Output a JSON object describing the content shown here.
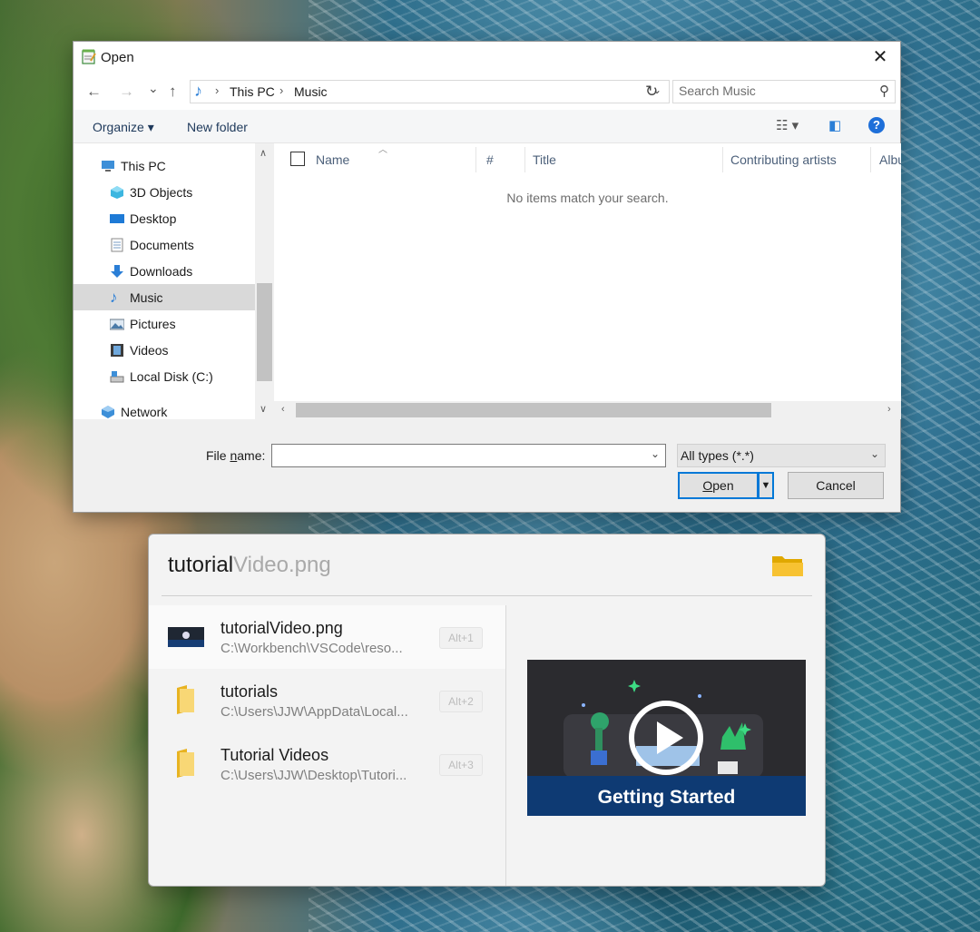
{
  "dialog": {
    "title": "Open",
    "close_glyph": "✕",
    "nav": {
      "back": "←",
      "forward": "→",
      "recent": "⌄",
      "up": "↑",
      "refresh": "↻"
    },
    "address": [
      "This PC",
      "Music"
    ],
    "search_placeholder": "Search Music",
    "commands": {
      "organize": "Organize ▾",
      "new_folder": "New folder"
    },
    "help_glyph": "?",
    "tree": [
      {
        "label": "This PC",
        "icon": "this-pc-icon"
      },
      {
        "label": "3D Objects",
        "icon": "3d-objects-icon"
      },
      {
        "label": "Desktop",
        "icon": "desktop-icon"
      },
      {
        "label": "Documents",
        "icon": "documents-icon"
      },
      {
        "label": "Downloads",
        "icon": "downloads-icon"
      },
      {
        "label": "Music",
        "icon": "music-icon",
        "selected": true
      },
      {
        "label": "Pictures",
        "icon": "pictures-icon"
      },
      {
        "label": "Videos",
        "icon": "videos-icon"
      },
      {
        "label": "Local Disk (C:)",
        "icon": "drive-icon"
      },
      {
        "label": "Network",
        "icon": "network-icon"
      }
    ],
    "columns": [
      "Name",
      "#",
      "Title",
      "Contributing artists",
      "Albu"
    ],
    "empty_message": "No items match your search.",
    "file_name_label_pre": "File ",
    "file_name_label_u": "n",
    "file_name_label_post": "ame:",
    "file_name_value": "",
    "file_type": "All types (*.*)",
    "open_label_u": "O",
    "open_label_rest": "pen",
    "cancel_label": "Cancel"
  },
  "quick_panel": {
    "query_typed": "tutorial",
    "query_suggestion": "Video.png",
    "results": [
      {
        "name_bold": "tutorial",
        "name_rest": "Video.png",
        "path": "C:\\Workbench\\VSCode\\reso...",
        "hotkey": "Alt+1",
        "kind": "image",
        "selected": true
      },
      {
        "name_bold": "tutorial",
        "name_rest": "s",
        "path": "C:\\Users\\JJW\\AppData\\Local...",
        "hotkey": "Alt+2",
        "kind": "folder"
      },
      {
        "name_bold": "Tutorial",
        "name_rest": " Videos",
        "path": "C:\\Users\\JJW\\Desktop\\Tutori...",
        "hotkey": "Alt+3",
        "kind": "folder"
      }
    ],
    "preview_caption": "Getting Started"
  },
  "colors": {
    "accent": "#0078d7",
    "link": "#1e395b",
    "selection": "#d9d9d9",
    "folder": "#f5c542"
  }
}
